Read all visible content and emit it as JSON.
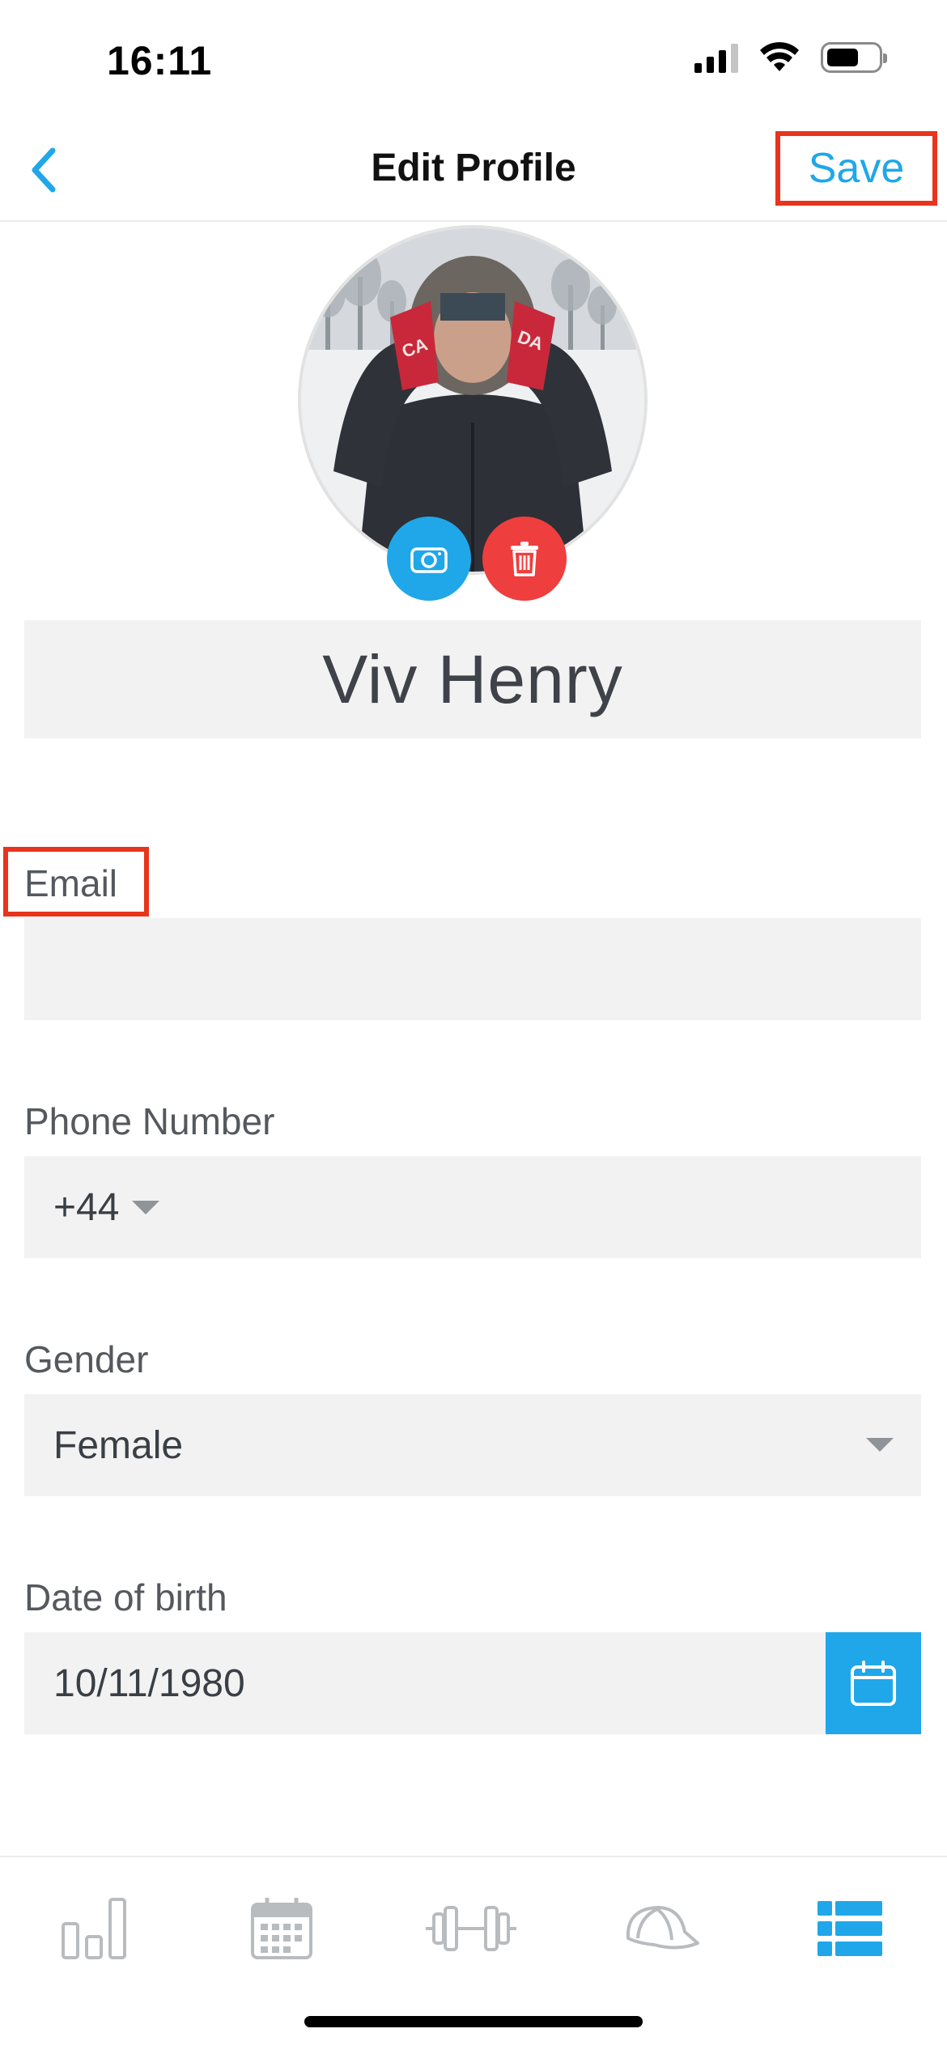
{
  "status_bar": {
    "time": "16:11"
  },
  "nav": {
    "title": "Edit Profile",
    "save_label": "Save"
  },
  "profile": {
    "name": "Viv Henry"
  },
  "form": {
    "email": {
      "label": "Email",
      "value": ""
    },
    "phone": {
      "label": "Phone Number",
      "country_code": "+44",
      "value": ""
    },
    "gender": {
      "label": "Gender",
      "value": "Female"
    },
    "dob": {
      "label": "Date of birth",
      "value": "10/11/1980"
    }
  },
  "tabs": [
    {
      "icon": "bar-chart-icon",
      "active": false
    },
    {
      "icon": "calendar-icon",
      "active": false
    },
    {
      "icon": "dumbbell-icon",
      "active": false
    },
    {
      "icon": "cap-icon",
      "active": false
    },
    {
      "icon": "list-icon",
      "active": true
    }
  ],
  "colors": {
    "accent": "#1fa7e9",
    "danger": "#ef3e3e",
    "highlight": "#e8341c",
    "field_bg": "#f2f2f2",
    "inactive_icon": "#b9bcbf"
  }
}
